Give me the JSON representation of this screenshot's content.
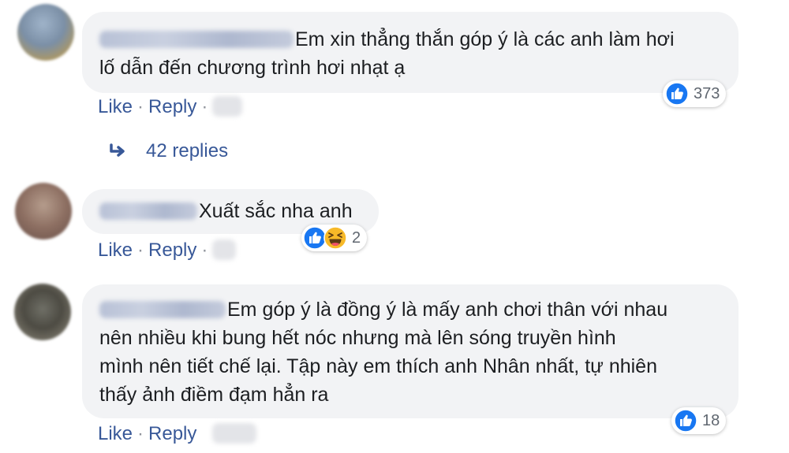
{
  "comments": [
    {
      "text_lines": [
        "Em xin thẳng thắn góp ý là các anh làm hơi",
        "lố dẫn đến chương trình hơi nhạt ạ"
      ],
      "like_label": "Like",
      "reply_label": "Reply",
      "separator": "·",
      "reaction_count": "373",
      "reaction_icons": [
        "like-icon"
      ]
    },
    {
      "text_lines": [
        "Xuất sắc nha anh"
      ],
      "like_label": "Like",
      "reply_label": "Reply",
      "separator": "·",
      "reaction_count": "2",
      "reaction_icons": [
        "like-icon",
        "haha-icon"
      ]
    },
    {
      "text_lines": [
        "Em góp ý là đồng ý là mấy anh chơi thân với nhau",
        "nên nhiều khi bung hết nóc nhưng mà lên sóng truyền hình",
        "mình nên tiết chế lại. Tập này em thích anh Nhân nhất, tự nhiên",
        "thấy ảnh điềm đạm hẳn ra"
      ],
      "like_label": "Like",
      "reply_label": "Reply",
      "reaction_count": "18",
      "reaction_icons": [
        "like-icon"
      ]
    }
  ],
  "replies_link": {
    "label": "42 replies",
    "icon": "reply-arrow-icon"
  },
  "colors": {
    "bubble_bg": "#f2f3f5",
    "link_blue": "#385898",
    "like_blue": "#1877f2",
    "haha_yellow": "#f7b928",
    "count_gray": "#606770"
  }
}
